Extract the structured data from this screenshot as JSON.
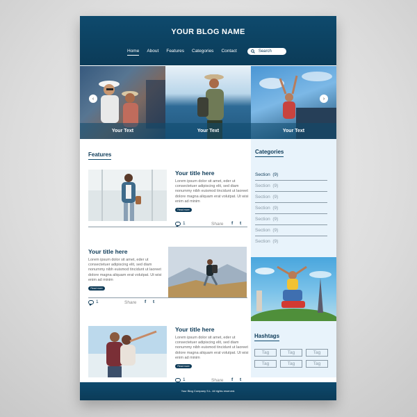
{
  "header": {
    "blog_name": "YOUR BLOG NAME",
    "nav": [
      {
        "label": "Home",
        "active": true
      },
      {
        "label": "About",
        "active": false
      },
      {
        "label": "Features",
        "active": false
      },
      {
        "label": "Categories",
        "active": false
      },
      {
        "label": "Contact",
        "active": false
      }
    ],
    "search_label": "Search",
    "search_icon": "search-icon"
  },
  "slider": {
    "slides": [
      {
        "caption": "Your Text",
        "scene": "two travelers with sunglasses and hats"
      },
      {
        "caption": "Your Text",
        "scene": "traveler with hat at sea"
      },
      {
        "caption": "Your Text",
        "scene": "woman with raised arms at car"
      }
    ],
    "prev_icon": "chevron-left-icon",
    "next_icon": "chevron-right-icon"
  },
  "features": {
    "title": "Features",
    "posts": [
      {
        "title": "Your title here",
        "text": "Lorem ipsum dolor sit amet, eder ut consectetuer adipiscing elit, sed diam nonummy nibh euismod tincidunt ut laoreet dolore magna aliquam erat volutpat. Ut wisi enim ad minim",
        "read_more": "Read more",
        "comments": "1",
        "share_label": "Share"
      },
      {
        "title": "Your title here",
        "text": "Lorem ipsum dolor sit amet, eder ut consectetuer adipiscing elit, sed diam nonummy nibh euismod tincidunt ut laoreet dolore magna aliquam erat volutpat. Ut wisi enim ad minim",
        "read_more": "Read more",
        "comments": "1",
        "share_label": "Share"
      },
      {
        "title": "Your title here",
        "text": "Lorem ipsum dolor sit amet, eder ut consectetuer adipiscing elit, sed diam nonummy nibh euismod tincidunt ut laoreet dolore magna aliquam erat volutpat. Ut wisi enim ad minim",
        "read_more": "Read more",
        "comments": "1",
        "share_label": "Share"
      }
    ],
    "social": {
      "facebook": "f",
      "twitter": "t"
    }
  },
  "sidebar": {
    "categories_title": "Categories",
    "categories": [
      {
        "label": "Section",
        "count": "(9)"
      },
      {
        "label": "Section",
        "count": "(9)"
      },
      {
        "label": "Section",
        "count": "(9)"
      },
      {
        "label": "Section",
        "count": "(9)"
      },
      {
        "label": "Section",
        "count": "(9)"
      },
      {
        "label": "Section",
        "count": "(9)"
      },
      {
        "label": "Section",
        "count": "(9)"
      }
    ],
    "hashtags_title": "Hashtags",
    "tags": [
      "Tag",
      "Tag",
      "Tag",
      "Tag",
      "Tag",
      "Tag"
    ]
  },
  "footer": {
    "text": "Your Blog Company S.L. All rights reserved."
  },
  "colors": {
    "primary": "#0e4a6d",
    "dark": "#0b3b58",
    "sidebar_bg": "#e8f3fb",
    "muted": "#8a9aa6"
  }
}
